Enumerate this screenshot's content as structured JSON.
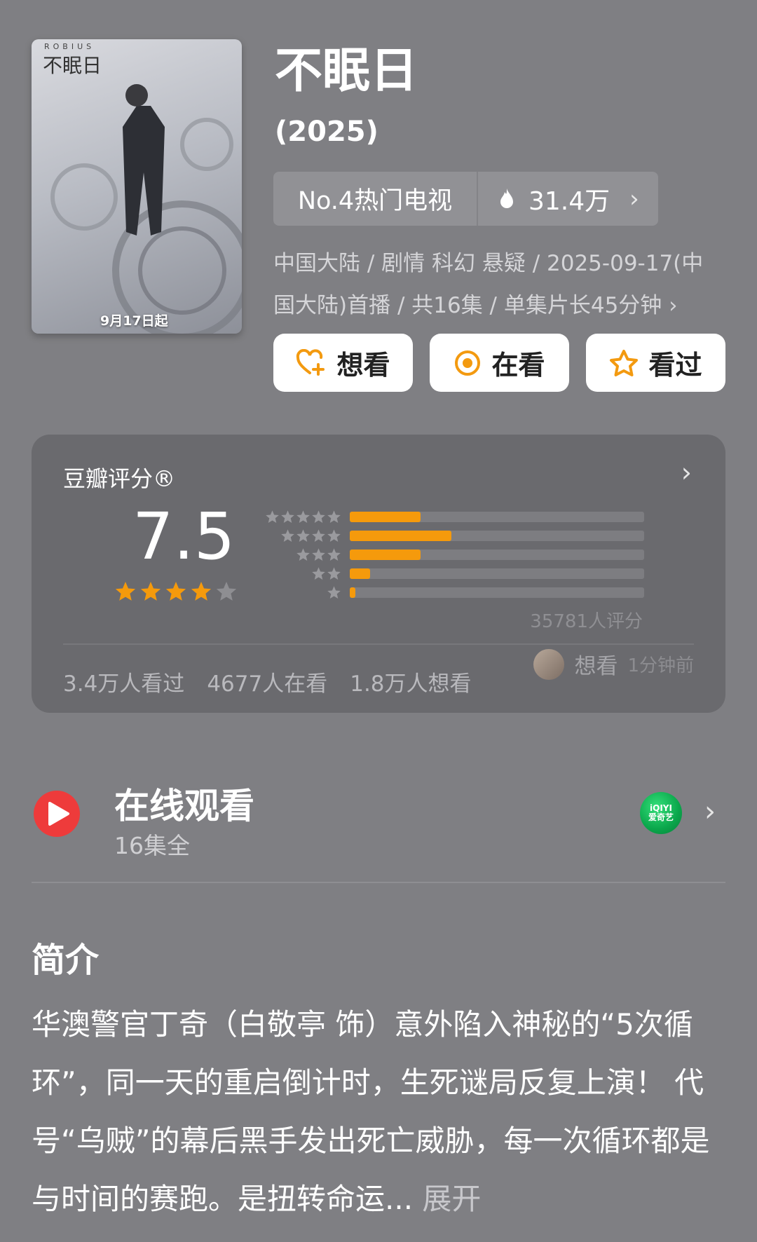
{
  "poster": {
    "brand": "ROBIUS",
    "title": "不眠日",
    "date_text": "9月17日起"
  },
  "header": {
    "title": "不眠日",
    "year": "(2025)",
    "rank_label": "No.4热门电视",
    "heat_value": "31.4万",
    "meta_line1": "中国大陆 / 剧情 科幻 悬疑 / 2025-09-17(中",
    "meta_line2": "国大陆)首播 / 共16集 / 单集片长45分钟 ›"
  },
  "actions": {
    "want": "想看",
    "watching": "在看",
    "watched": "看过"
  },
  "rating": {
    "title": "豆瓣评分®",
    "score": "7.5",
    "stars": 4,
    "distribution": [
      {
        "stars": 5,
        "fraction": 0.24
      },
      {
        "stars": 4,
        "fraction": 0.345
      },
      {
        "stars": 3,
        "fraction": 0.24
      },
      {
        "stars": 2,
        "fraction": 0.07
      },
      {
        "stars": 1,
        "fraction": 0.02
      }
    ],
    "raters": "35781人评分",
    "watched_count": "3.4万人看过",
    "watching_count": "4677人在看",
    "want_count": "1.8万人想看",
    "activity_label": "想看",
    "activity_time": "1分钟前"
  },
  "online": {
    "title": "在线观看",
    "subtitle": "16集全",
    "provider_logo_line1": "iQIYI",
    "provider_logo_line2": "爱奇艺"
  },
  "intro": {
    "title": "简介",
    "text": "华澳警官丁奇（白敬亭 饰）意外陷入神秘的“5次循环”，同一天的重启倒计时，生死谜局反复上演！ 代号“乌贼”的幕后黑手发出死亡威胁，每一次循环都是与时间的赛跑。是扭转命运...",
    "more": "展开"
  },
  "colors": {
    "background": "#7f7f83",
    "card": "#6a6a6e",
    "accent_orange": "#f59a0c",
    "play_red": "#ee3b3b"
  }
}
